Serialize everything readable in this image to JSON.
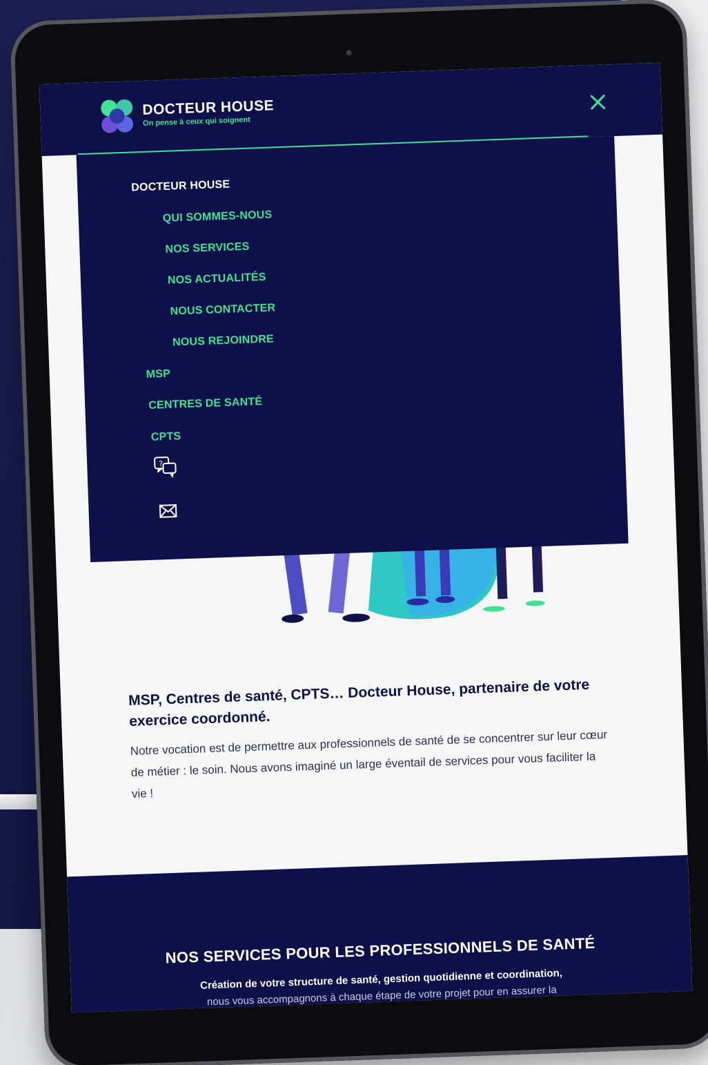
{
  "brand": {
    "name": "DOCTEUR HOUSE",
    "tagline": "On pense à ceux qui soignent"
  },
  "header": {
    "close_icon": "close-icon"
  },
  "menu": {
    "items": [
      {
        "label": "DOCTEUR HOUSE",
        "level": "top"
      },
      {
        "label": "QUI SOMMES-NOUS",
        "level": "sub"
      },
      {
        "label": "NOS SERVICES",
        "level": "sub"
      },
      {
        "label": "NOS ACTUALITÉS",
        "level": "sub"
      },
      {
        "label": "NOUS CONTACTER",
        "level": "sub"
      },
      {
        "label": "NOUS REJOINDRE",
        "level": "sub"
      },
      {
        "label": "MSP",
        "level": "top"
      },
      {
        "label": "CENTRES DE SANTÉ",
        "level": "top"
      },
      {
        "label": "CPTS",
        "level": "top"
      }
    ],
    "icons": [
      "faq-chat-icon",
      "mail-icon"
    ]
  },
  "intro": {
    "heading": "MSP, Centres de santé, CPTS… Docteur House, partenaire de votre exercice coordonné.",
    "body": "Notre vocation est de permettre aux professionnels de santé de se concentrer sur leur cœur de métier : le soin. Nous avons imaginé un large éventail de services pour vous faciliter la vie !"
  },
  "services": {
    "title": "NOS SERVICES POUR LES PROFESSIONNELS DE SANTÉ",
    "subtitle_line1": "Création de votre structure de santé, gestion quotidienne et coordination,",
    "subtitle_line2": "nous vous accompagnons à chaque étape de votre projet pour en assurer la"
  },
  "colors": {
    "navy": "#0e1049",
    "green": "#40e391",
    "white": "#ffffff"
  }
}
